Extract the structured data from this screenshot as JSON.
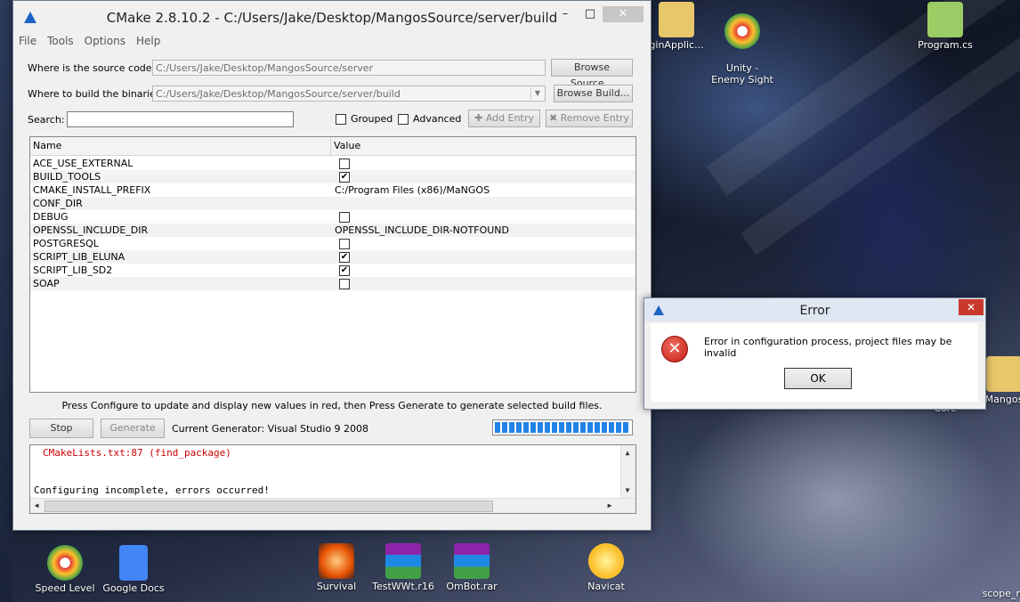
{
  "window": {
    "title": "CMake 2.8.10.2 - C:/Users/Jake/Desktop/MangosSource/server/build",
    "minimize": "–",
    "maximize": "□",
    "close": "✕"
  },
  "menu": [
    "File",
    "Tools",
    "Options",
    "Help"
  ],
  "source": {
    "label": "Where is the source code:",
    "value": "C:/Users/Jake/Desktop/MangosSource/server",
    "button": "Browse Source..."
  },
  "build": {
    "label": "Where to build the binaries:",
    "value": "C:/Users/Jake/Desktop/MangosSource/server/build",
    "button": "Browse Build..."
  },
  "search": {
    "label": "Search:",
    "value": ""
  },
  "options": {
    "grouped": "Grouped",
    "advanced": "Advanced",
    "add_entry": "Add Entry",
    "remove_entry": "Remove Entry"
  },
  "table": {
    "headers": [
      "Name",
      "Value"
    ],
    "rows": [
      {
        "name": "ACE_USE_EXTERNAL",
        "type": "bool",
        "checked": false,
        "value": ""
      },
      {
        "name": "BUILD_TOOLS",
        "type": "bool",
        "checked": true,
        "value": ""
      },
      {
        "name": "CMAKE_INSTALL_PREFIX",
        "type": "text",
        "checked": false,
        "value": "C:/Program Files (x86)/MaNGOS"
      },
      {
        "name": "CONF_DIR",
        "type": "text",
        "checked": false,
        "value": ""
      },
      {
        "name": "DEBUG",
        "type": "bool",
        "checked": false,
        "value": ""
      },
      {
        "name": "OPENSSL_INCLUDE_DIR",
        "type": "text",
        "checked": false,
        "value": "OPENSSL_INCLUDE_DIR-NOTFOUND"
      },
      {
        "name": "POSTGRESQL",
        "type": "bool",
        "checked": false,
        "value": ""
      },
      {
        "name": "SCRIPT_LIB_ELUNA",
        "type": "bool",
        "checked": true,
        "value": ""
      },
      {
        "name": "SCRIPT_LIB_SD2",
        "type": "bool",
        "checked": true,
        "value": ""
      },
      {
        "name": "SOAP",
        "type": "bool",
        "checked": false,
        "value": ""
      }
    ]
  },
  "hint": "Press Configure to update and display new values in red, then Press Generate to generate selected build files.",
  "actions": {
    "stop": "Stop",
    "generate": "Generate",
    "generator": "Current Generator: Visual Studio 9 2008"
  },
  "progress": {
    "fraction": 1.0
  },
  "log": {
    "line1": "CMakeLists.txt:87 (find_package)",
    "line2": "Configuring incomplete, errors occurred!"
  },
  "dialog": {
    "title": "Error",
    "message": "Error in configuration process, project files may be invalid",
    "ok": "OK",
    "close": "✕"
  },
  "desktop_icons": [
    {
      "label": "Unity -\nEnemy Sight"
    },
    {
      "label": "Program.cs"
    },
    {
      "label": "Speed Level"
    },
    {
      "label": "Google Docs"
    },
    {
      "label": "Survival"
    },
    {
      "label": "TestWWt.r16"
    },
    {
      "label": "OmBot.rar"
    },
    {
      "label": "Navicat"
    },
    {
      "label": "Core"
    },
    {
      "label": "Mangos"
    },
    {
      "label": "scope_re"
    },
    {
      "label": "ginApplic..."
    }
  ],
  "colors": {
    "error_red": "#c41e12",
    "progress_blue": "#2383e6",
    "log_error": "#cc0000"
  }
}
